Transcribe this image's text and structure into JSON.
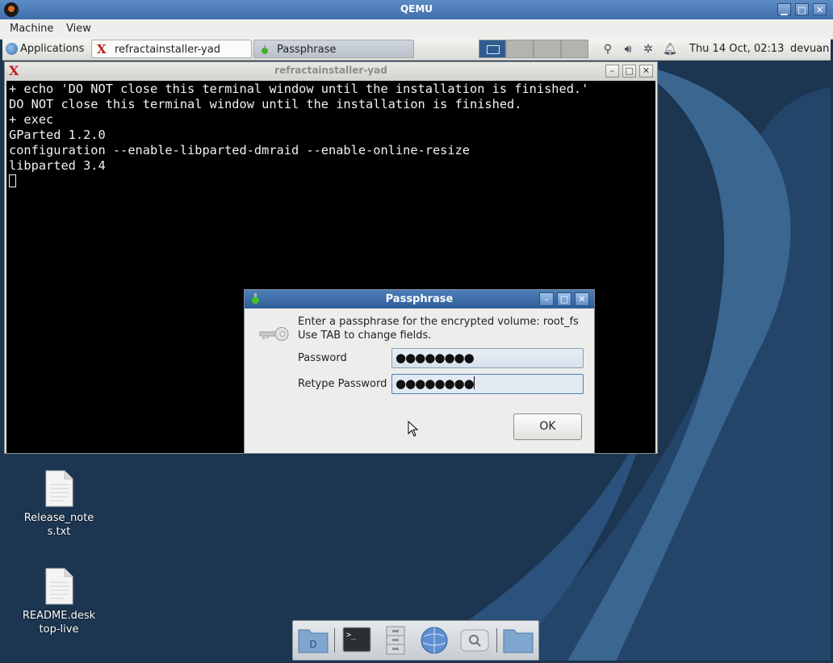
{
  "qemu": {
    "title": "QEMU",
    "menu": [
      "Machine",
      "View"
    ]
  },
  "panel": {
    "applications_label": "Applications",
    "tasks": [
      {
        "label": "refractainstaller-yad",
        "icon": "refracta-icon"
      },
      {
        "label": "Passphrase",
        "icon": "green-flask-icon"
      }
    ],
    "clock": "Thu 14 Oct, 02:13",
    "user": "devuan"
  },
  "terminal": {
    "title": "refractainstaller-yad",
    "lines": [
      "+ echo 'DO NOT close this terminal window until the installation is finished.'",
      "DO NOT close this terminal window until the installation is finished.",
      "+ exec",
      "GParted 1.2.0",
      "configuration --enable-libparted-dmraid --enable-online-resize",
      "libparted 3.4"
    ]
  },
  "dialog": {
    "title": "Passphrase",
    "message_line1": "Enter a passphrase for the encrypted volume: root_fs",
    "message_line2": "Use TAB to change fields.",
    "password_label": "Password",
    "password_value": "●●●●●●●●",
    "retype_label": "Retype Password",
    "retype_value": "●●●●●●●●",
    "ok_label": "OK"
  },
  "desktop_icons": [
    {
      "label_line1": "Release_note",
      "label_line2": "s.txt"
    },
    {
      "label_line1": "README.desk",
      "label_line2": "top-live"
    }
  ],
  "dock": [
    "file-manager-D-icon",
    "terminal-icon",
    "filing-cabinet-icon",
    "web-browser-icon",
    "search-icon",
    "folder-icon"
  ]
}
